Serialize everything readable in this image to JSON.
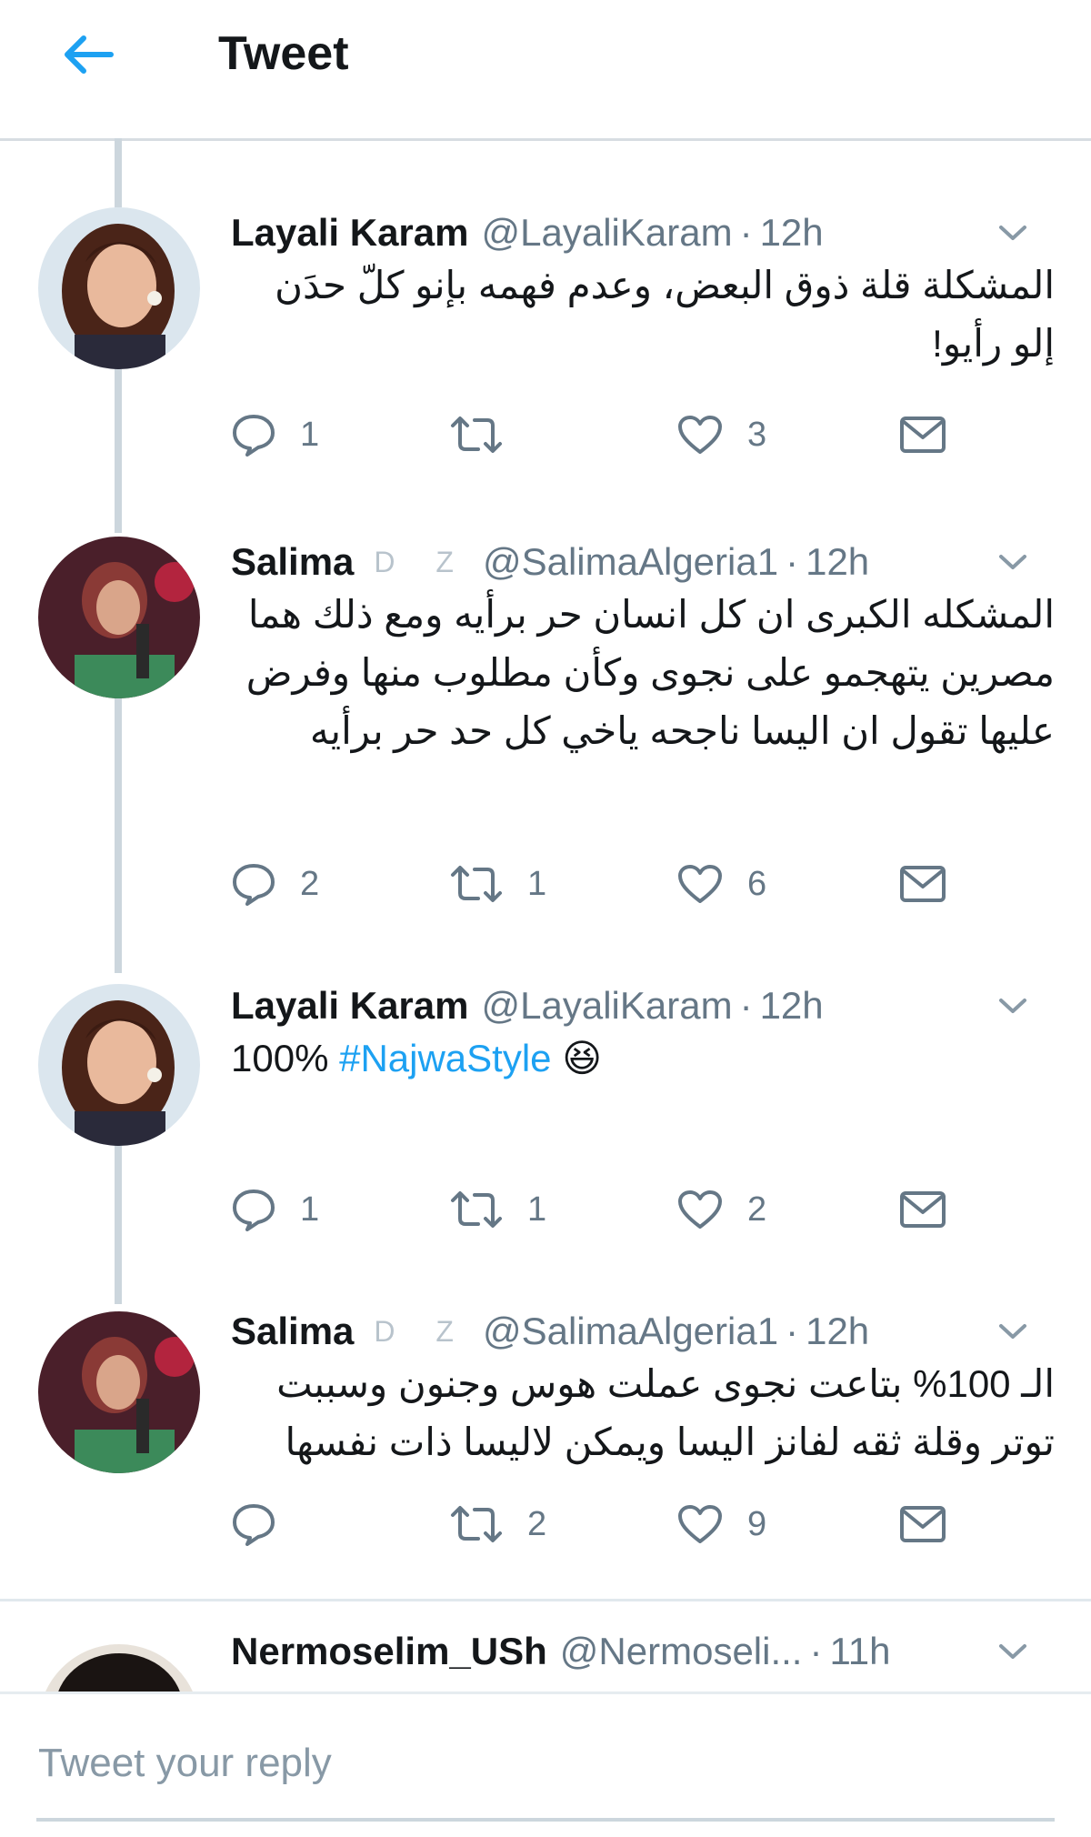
{
  "header": {
    "title": "Tweet",
    "back_icon": "arrow-left-icon",
    "accent": "#1da1f2"
  },
  "tweets": [
    {
      "name": "Layali Karam",
      "handle": "@LayaliKaram",
      "time": "12h",
      "badges": "",
      "text": "المشكلة قلة ذوق البعض، وعدم فهمه بإنو كلّ حدَن إلو رأيو!",
      "replies": "1",
      "retweets": "",
      "likes": "3"
    },
    {
      "name": "Salima",
      "handle": "@SalimaAlgeria1",
      "time": "12h",
      "badges": "D Z",
      "text": "المشكله الكبرى ان كل انسان حر برأيه ومع ذلك هما مصرين يتهجمو على نجوى وكأن مطلوب منها وفرض عليها تقول ان اليسا ناجحه ياخي كل حد حر برأيه",
      "replies": "2",
      "retweets": "1",
      "likes": "6"
    },
    {
      "name": "Layali Karam",
      "handle": "@LayaliKaram",
      "time": "12h",
      "badges": "",
      "text": "100%",
      "hashtag": "#NajwaStyle",
      "emoji": "😆",
      "replies": "1",
      "retweets": "1",
      "likes": "2"
    },
    {
      "name": "Salima",
      "handle": "@SalimaAlgeria1",
      "time": "12h",
      "badges": "D Z",
      "text": "الـ 100% بتاعت نجوى عملت هوس وجنون وسببت توتر وقلة ثقه لفانز اليسا ويمكن لاليسا ذات نفسها",
      "replies": "",
      "retweets": "2",
      "likes": "9"
    },
    {
      "name": "Nermoselim_USh",
      "handle": "@Nermoseli...",
      "time": "11h"
    }
  ],
  "separator": "·",
  "reply": {
    "placeholder": "Tweet your reply"
  }
}
